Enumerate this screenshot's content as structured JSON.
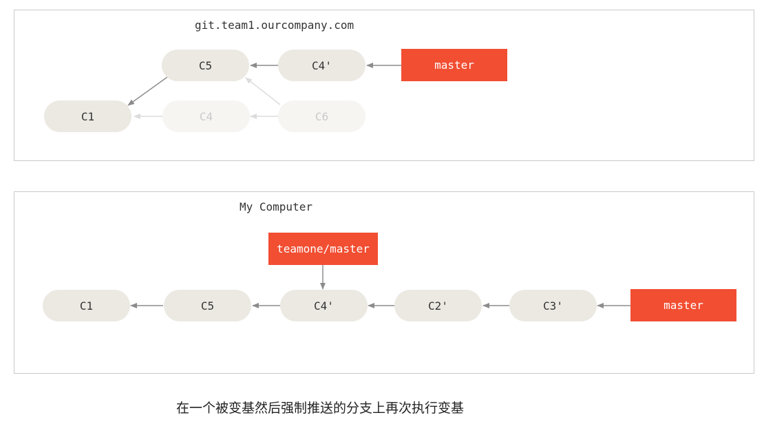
{
  "colors": {
    "commit_fill": "#ebe9e2",
    "commit_faded_fill": "#f6f5f2",
    "branch_fill": "#f14e32",
    "arrow": "#8c8c8c",
    "arrow_faded": "#dcdcdc"
  },
  "remote": {
    "title": "git.team1.ourcompany.com",
    "commits": {
      "c1": "C1",
      "c5": "C5",
      "c4p": "C4'",
      "c4": "C4",
      "c6": "C6"
    },
    "branches": {
      "master": "master"
    }
  },
  "local": {
    "title": "My Computer",
    "commits": {
      "c1": "C1",
      "c5": "C5",
      "c4p": "C4'",
      "c2p": "C2'",
      "c3p": "C3'"
    },
    "branches": {
      "teamone_master": "teamone/master",
      "master": "master"
    }
  },
  "caption": "在一个被变基然后强制推送的分支上再次执行变基"
}
